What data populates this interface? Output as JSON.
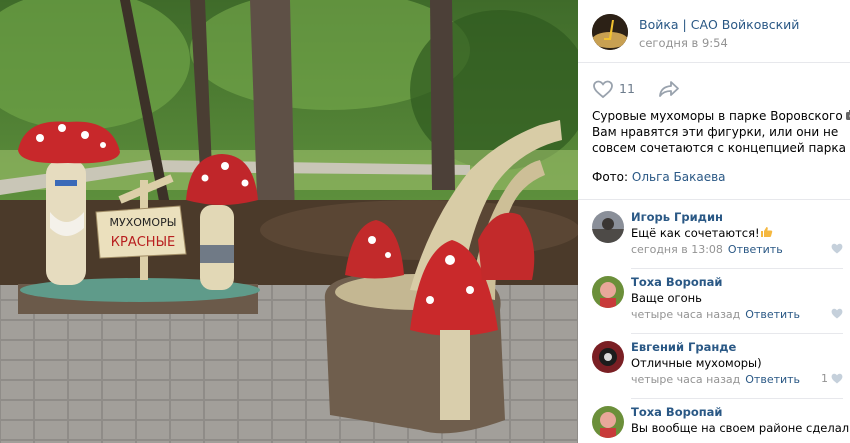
{
  "post": {
    "group_name": "Войка | САО Войковский",
    "time": "сегодня в 9:54",
    "like_count": "11",
    "text_lines": [
      "Суровые мухоморы в парке Воровского",
      "Вам нравятся эти фигурки, или они не",
      "совсем сочетаются с концепцией парка ?"
    ],
    "photo_credit_prefix": "Фото: ",
    "photo_credit_name": "Ольга Бакаева"
  },
  "photo": {
    "sign_line1": "МУХОМОРЫ",
    "sign_line2": "КРАСНЫЕ"
  },
  "comments": [
    {
      "author": "Игорь Гридин",
      "text": "Ещё как сочетаются!",
      "has_emoji": true,
      "time": "сегодня в 13:08",
      "reply": "Ответить",
      "likes": ""
    },
    {
      "author": "Тоха Воропай",
      "text": "Ваще огонь",
      "has_emoji": false,
      "time": "четыре часа назад",
      "reply": "Ответить",
      "likes": ""
    },
    {
      "author": "Евгений Гранде",
      "text": "Отличные мухоморы)",
      "has_emoji": false,
      "time": "четыре часа назад",
      "reply": "Ответить",
      "likes": "1"
    },
    {
      "author": "Тоха Воропай",
      "text": "Вы вообще на своем районе сделали",
      "has_emoji": false,
      "time": "",
      "reply": "",
      "likes": ""
    }
  ],
  "icons": {
    "like": "heart-outline-icon",
    "share": "share-arrow-icon",
    "comment_like": "heart-icon",
    "post_emoji": "camera-emoji",
    "comment_emoji": "thumbs-up-emoji"
  },
  "colors": {
    "link": "#2a5885",
    "muted": "#939393",
    "divider": "#e7e8ec",
    "icon": "#99a2ad"
  }
}
